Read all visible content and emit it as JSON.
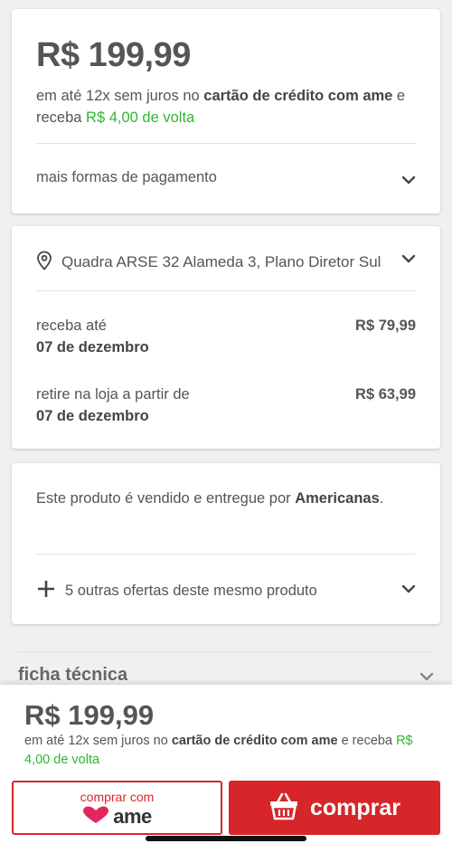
{
  "price_card": {
    "price": "R$ 199,99",
    "installments_prefix": "em até 12x sem juros no ",
    "installments_bold": "cartão de crédito com ame",
    "installments_mid": " e receba ",
    "cashback": "R$ 4,00 de volta",
    "more_payments": "mais formas de pagamento"
  },
  "shipping_card": {
    "address": "Quadra ARSE 32 Alameda 3, Plano Diretor Sul",
    "options": [
      {
        "label": "receba até",
        "date": "07 de dezembro",
        "price": "R$ 79,99"
      },
      {
        "label": "retire na loja a partir de",
        "date": "07 de dezembro",
        "price": "R$ 63,99"
      }
    ]
  },
  "seller_card": {
    "text_prefix": "Este produto é vendido e entregue por ",
    "seller": "Americanas",
    "suffix": ".",
    "other_offers": "5 outras ofertas deste mesmo produto"
  },
  "ficha": {
    "title": "ficha técnica"
  },
  "bottom_bar": {
    "price": "R$ 199,99",
    "installments_prefix": "em até 12x sem juros no ",
    "installments_bold": "cartão de crédito com ame",
    "installments_mid": " e receba ",
    "cashback": "R$ 4,00 de volta",
    "ame_button_label": "comprar com",
    "ame_logo_text": "ame",
    "buy_label": "comprar"
  },
  "colors": {
    "accent_red": "#d7262a",
    "cashback_green": "#2eb82e"
  },
  "icons": [
    "chevron-down-icon",
    "location-pin-icon",
    "plus-icon",
    "heart-logo-icon",
    "basket-icon"
  ]
}
